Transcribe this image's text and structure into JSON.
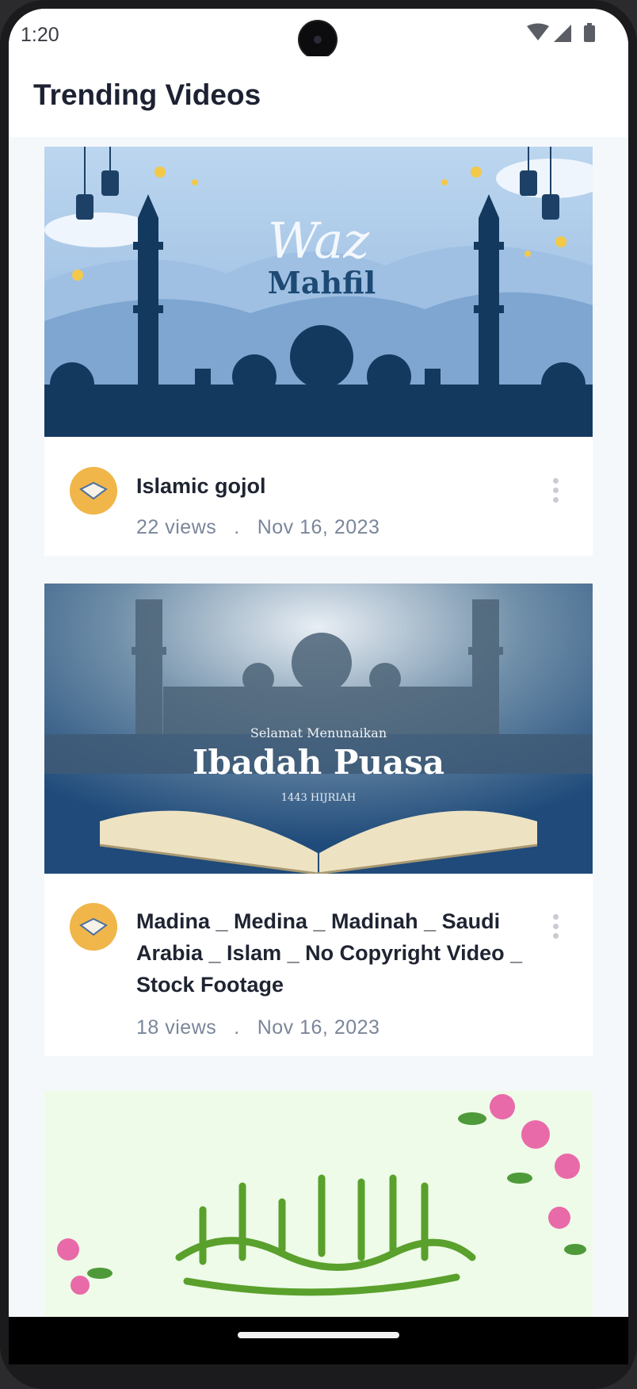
{
  "status_bar": {
    "time": "1:20",
    "icons": [
      "wifi-icon",
      "signal-icon",
      "battery-icon"
    ]
  },
  "header": {
    "title": "Trending Videos"
  },
  "videos": [
    {
      "title": "Islamic gojol",
      "views": "22 views",
      "separator": ".",
      "date": "Nov 16, 2023",
      "thumbnail": {
        "line1": "Waz",
        "line2": "Mahfil"
      }
    },
    {
      "title": "Madina _ Medina _ Madinah _ Saudi Arabia _ Islam _ No Copyright Video _ Stock Footage",
      "views": "18 views",
      "separator": ".",
      "date": "Nov 16, 2023",
      "thumbnail": {
        "line1": "Selamat Menunaikan",
        "line2": "Ibadah Puasa",
        "line3": "1443 HIJRIAH"
      }
    },
    {
      "title": "",
      "thumbnail": {}
    }
  ],
  "colors": {
    "accent_dark_blue": "#14395f",
    "sky_blue": "#a9c8e8",
    "green_calligraphy": "#5aa02c"
  }
}
